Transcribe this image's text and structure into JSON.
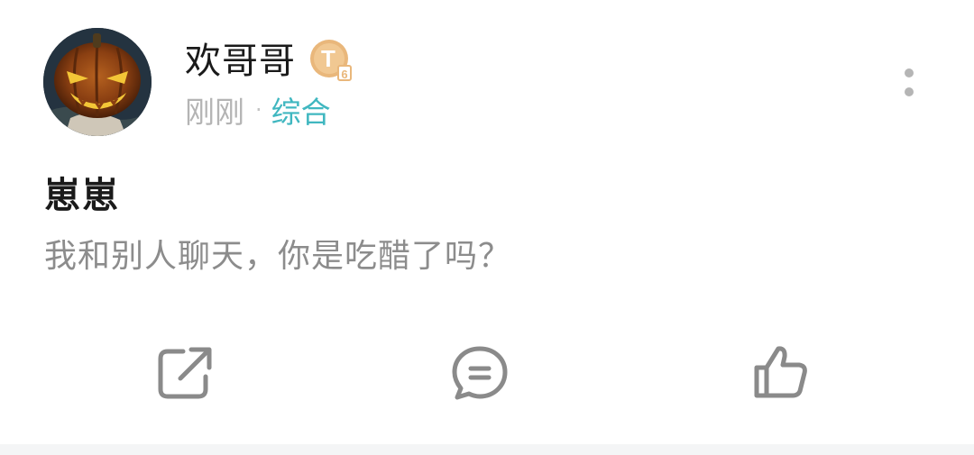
{
  "post": {
    "author": {
      "name": "欢哥哥",
      "level_badge": {
        "letter": "T",
        "level": "6",
        "color": "#e9b77b"
      }
    },
    "meta": {
      "time": "刚刚",
      "separator": "·",
      "category": "综合"
    },
    "title": "崽崽",
    "body": "我和别人聊天，你是吃醋了吗？",
    "actions": [
      {
        "name": "share",
        "icon": "share-icon"
      },
      {
        "name": "comment",
        "icon": "comment-icon"
      },
      {
        "name": "like",
        "icon": "thumbs-up-icon"
      }
    ]
  },
  "colors": {
    "category_accent": "#40b7c0",
    "meta_text": "#b4b4b4",
    "body_text": "#8c8c8c",
    "icon_stroke": "#8a8a8a",
    "divider": "#f4f5f6"
  }
}
